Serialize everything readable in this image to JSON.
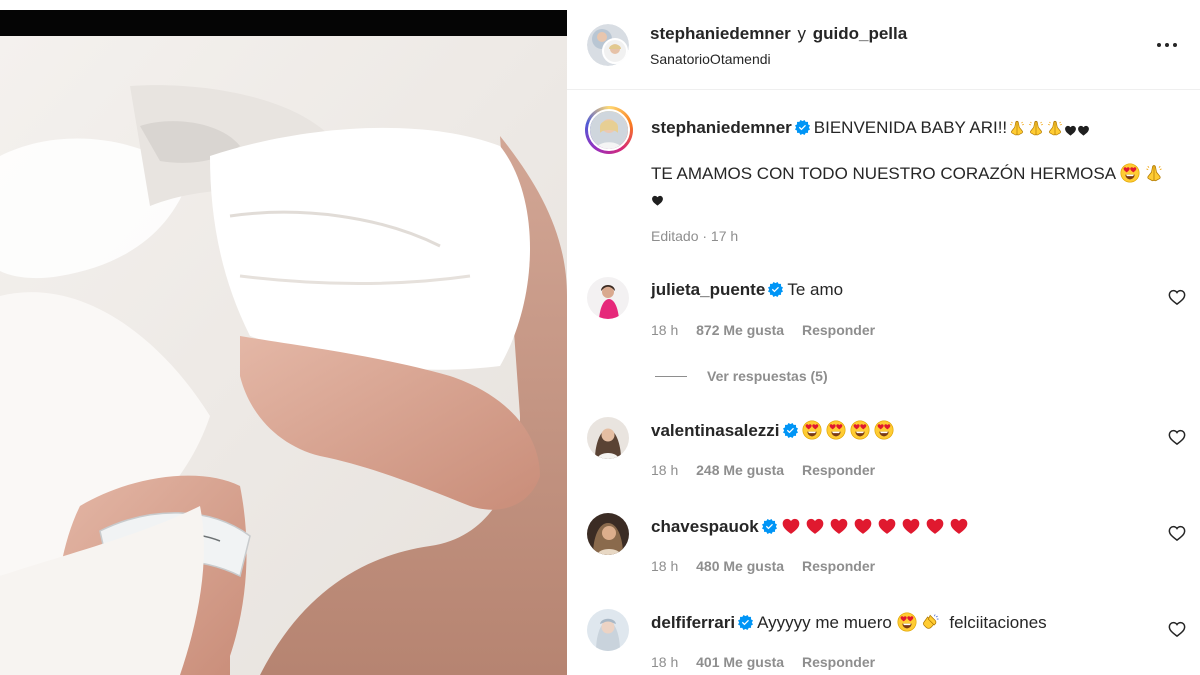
{
  "post": {
    "header": {
      "author": "stephaniedemner",
      "conjunction": "y",
      "collaborator": "guido_pella",
      "location": "SanatorioOtamendi"
    },
    "caption": {
      "username": "stephaniedemner",
      "line1_text": "BIENVENIDA BABY ARI!!",
      "line1_emojis": [
        "praying-hands",
        "praying-hands",
        "praying-hands",
        "black-heart",
        "black-heart"
      ],
      "line2_text": "TE AMAMOS CON TODO NUESTRO CORAZÓN HERMOSA",
      "line2_emojis": [
        "heart-eyes",
        "praying-hands",
        "black-heart"
      ],
      "meta": "Editado · 17 h"
    },
    "comments": [
      {
        "username": "julieta_puente",
        "text": "Te amo",
        "time": "18 h",
        "likes": "872 Me gusta",
        "reply": "Responder",
        "view_replies": "Ver respuestas (5)"
      },
      {
        "username": "valentinasalezzi",
        "text": "",
        "emojis": [
          "heart-eyes",
          "heart-eyes",
          "heart-eyes",
          "heart-eyes"
        ],
        "time": "18 h",
        "likes": "248 Me gusta",
        "reply": "Responder"
      },
      {
        "username": "chavespauok",
        "text": "",
        "emojis": [
          "red-heart",
          "red-heart",
          "red-heart",
          "red-heart",
          "red-heart",
          "red-heart",
          "red-heart",
          "red-heart"
        ],
        "time": "18 h",
        "likes": "480 Me gusta",
        "reply": "Responder"
      },
      {
        "username": "delfiferrari",
        "text": "Ayyyyy me muero",
        "text_after": "felciitaciones",
        "emojis": [
          "heart-eyes",
          "clapping-hands"
        ],
        "time": "18 h",
        "likes": "401 Me gusta",
        "reply": "Responder"
      }
    ]
  },
  "colors": {
    "text": "#262626",
    "secondary": "#8e8e8e",
    "verified": "#0095f6",
    "red_heart": "#e0192f"
  }
}
